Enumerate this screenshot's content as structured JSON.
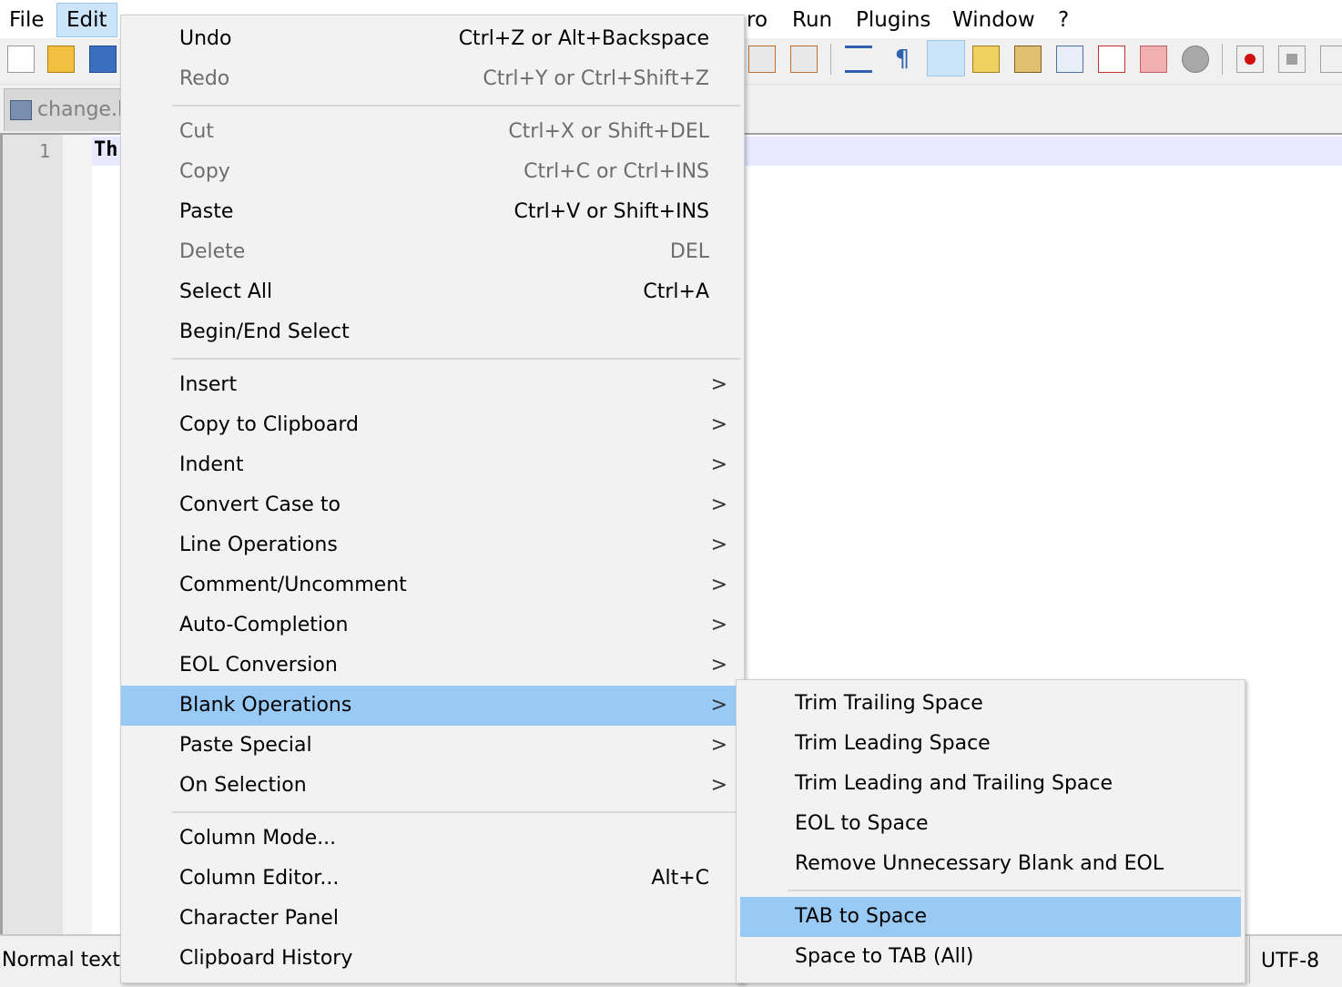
{
  "menubar": {
    "items": [
      "File",
      "Edit",
      "ro",
      "Run",
      "Plugins",
      "Window",
      "?"
    ]
  },
  "tab": {
    "label": "change.lo"
  },
  "editor": {
    "line_number": "1",
    "line_text": "Th"
  },
  "statusbar": {
    "left": "Normal text",
    "encoding": "UTF-8"
  },
  "edit_menu": {
    "group1": [
      {
        "label": "Undo",
        "shortcut": "Ctrl+Z or Alt+Backspace"
      },
      {
        "label": "Redo",
        "shortcut": "Ctrl+Y or Ctrl+Shift+Z"
      }
    ],
    "group2": [
      {
        "label": "Cut",
        "shortcut": "Ctrl+X or Shift+DEL"
      },
      {
        "label": "Copy",
        "shortcut": "Ctrl+C or Ctrl+INS"
      },
      {
        "label": "Paste",
        "shortcut": "Ctrl+V or Shift+INS"
      },
      {
        "label": "Delete",
        "shortcut": "DEL"
      },
      {
        "label": "Select All",
        "shortcut": "Ctrl+A"
      },
      {
        "label": "Begin/End Select",
        "shortcut": ""
      }
    ],
    "group3": [
      {
        "label": "Insert"
      },
      {
        "label": "Copy to Clipboard"
      },
      {
        "label": "Indent"
      },
      {
        "label": "Convert Case to"
      },
      {
        "label": "Line Operations"
      },
      {
        "label": "Comment/Uncomment"
      },
      {
        "label": "Auto-Completion"
      },
      {
        "label": "EOL Conversion"
      },
      {
        "label": "Blank Operations"
      },
      {
        "label": "Paste Special"
      },
      {
        "label": "On Selection"
      }
    ],
    "group4": [
      {
        "label": "Column Mode...",
        "shortcut": ""
      },
      {
        "label": "Column Editor...",
        "shortcut": "Alt+C"
      },
      {
        "label": "Character Panel",
        "shortcut": ""
      },
      {
        "label": "Clipboard History",
        "shortcut": ""
      }
    ],
    "submenu_arrow": ">"
  },
  "blank_operations_menu": {
    "group1": [
      "Trim Trailing Space",
      "Trim Leading Space",
      "Trim Leading and Trailing Space",
      "EOL to Space",
      "Remove Unnecessary Blank and EOL"
    ],
    "group2": [
      "TAB to Space",
      "Space to TAB (All)"
    ]
  },
  "colors": {
    "highlight": "#99c9f5",
    "menu_bg": "#f2f2f2",
    "active_menu": "#cce4f7"
  }
}
